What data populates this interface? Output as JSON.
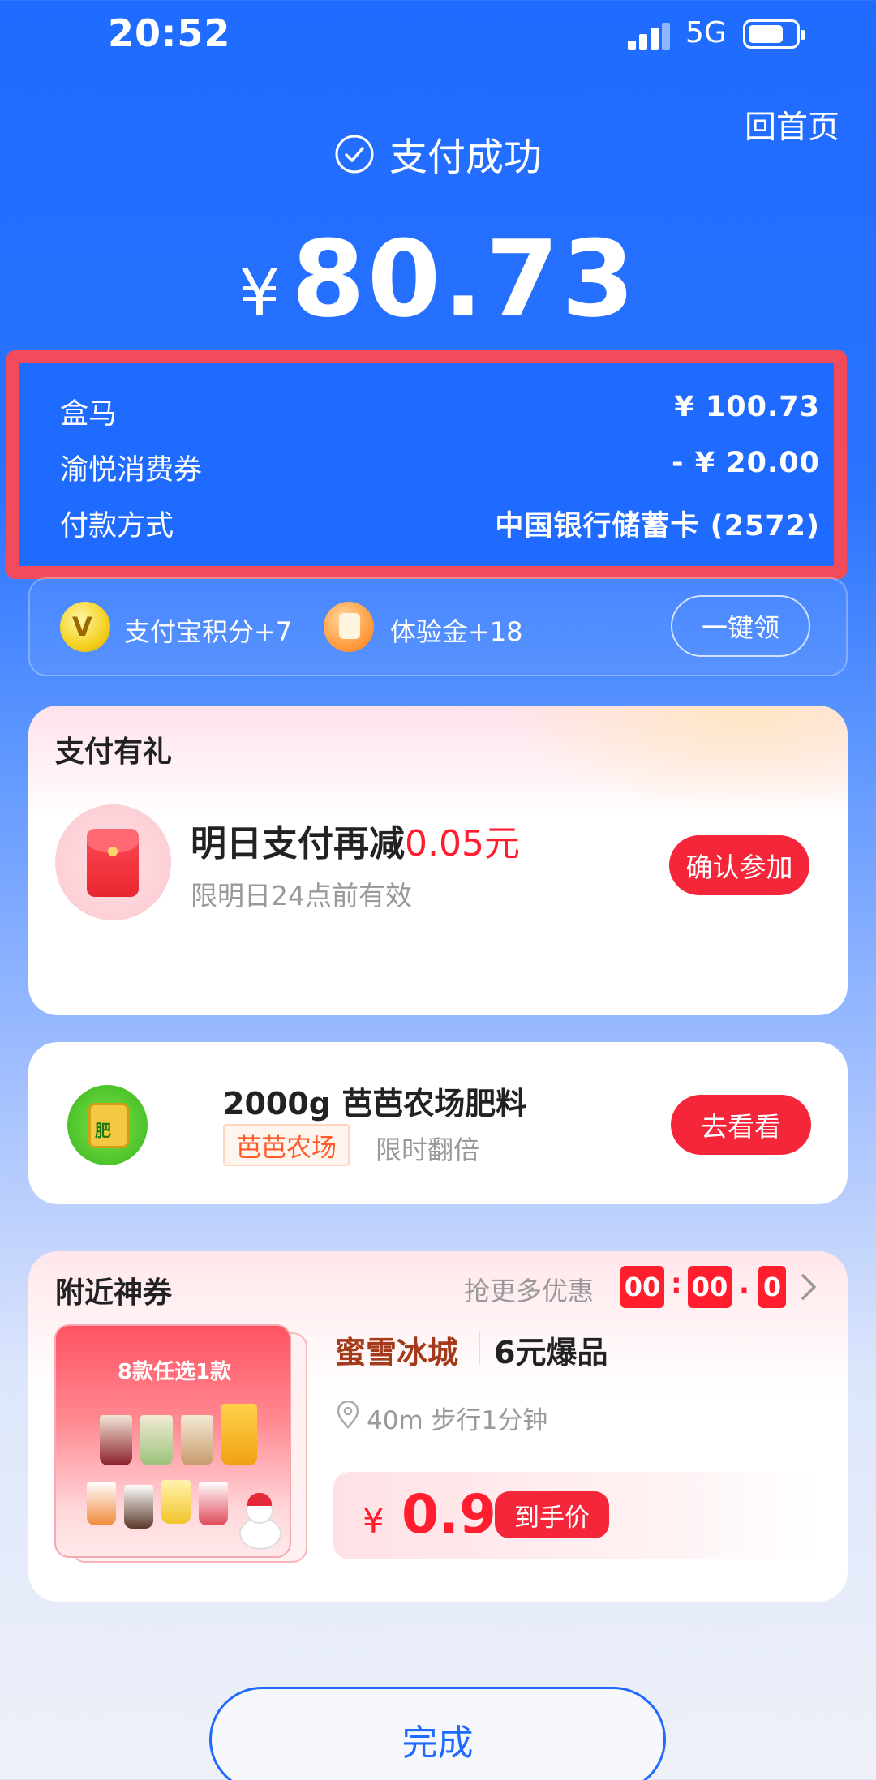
{
  "status_bar": {
    "time": "20:52",
    "network": "5G"
  },
  "header": {
    "home_link": "回首页",
    "title": "支付成功",
    "currency": "¥",
    "amount": "80.73"
  },
  "details": [
    {
      "label": "盒马",
      "value": "¥ 100.73"
    },
    {
      "label": "渝悦消费券",
      "value": "- ¥ 20.00"
    },
    {
      "label": "付款方式",
      "value": "中国银行储蓄卡 (2572)"
    }
  ],
  "rewards": {
    "points_label": "支付宝积分+7",
    "trial_label": "体验金+18",
    "claim_label": "一键领"
  },
  "gift_card": {
    "title": "支付有礼",
    "offer_prefix": "明日支付再减",
    "offer_amount": "0.05元",
    "offer_note": "限明日24点前有效",
    "button": "确认参加"
  },
  "farm_card": {
    "title": "2000g 芭芭农场肥料",
    "tag": "芭芭农场",
    "note": "限时翻倍",
    "icon_text": "肥",
    "button": "去看看"
  },
  "coupon_card": {
    "title": "附近神券",
    "more_text": "抢更多优惠",
    "countdown": {
      "h": "00",
      "m": "00",
      "ms": "0",
      "sep1": ":",
      "sep2": "."
    },
    "promo_text": "8款任选1款",
    "shop": "蜜雪冰城",
    "deal": "6元爆品",
    "distance": "40m 步行1分钟",
    "price_currency": "¥",
    "price": "0.9",
    "price_tag": "到手价"
  },
  "footer": {
    "done_label": "完成"
  },
  "colors": {
    "brand_blue": "#1f6bff",
    "accent_red": "#f5263a",
    "highlight_border": "#f24b5b"
  }
}
